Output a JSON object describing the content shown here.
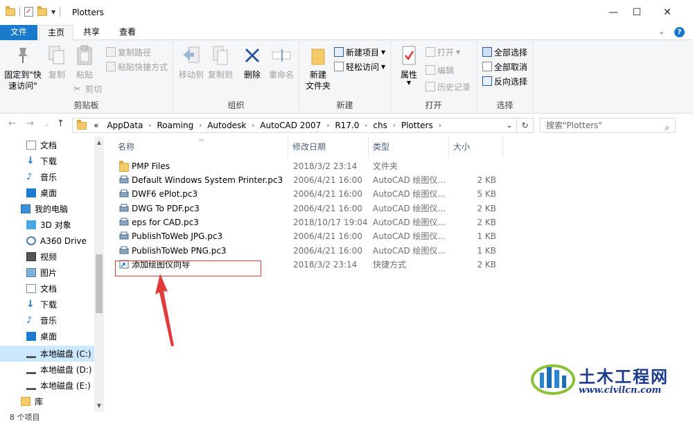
{
  "window": {
    "title": "Plotters"
  },
  "ribbon_tabs": {
    "file": "文件",
    "home": "主页",
    "share": "共享",
    "view": "查看"
  },
  "ribbon": {
    "clipboard": {
      "label": "剪贴板",
      "pin_line1": "固定到\"快",
      "pin_line2": "速访问\"",
      "copy": "复制",
      "paste": "粘贴",
      "copy_path": "复制路径",
      "paste_shortcut": "粘贴快捷方式",
      "cut": "剪切"
    },
    "organize": {
      "label": "组织",
      "move_to": "移动到",
      "copy_to": "复制到",
      "delete": "删除",
      "rename": "重命名"
    },
    "new": {
      "label": "新建",
      "new_folder_line1": "新建",
      "new_folder_line2": "文件夹",
      "new_item": "新建项目",
      "easy_access": "轻松访问"
    },
    "open": {
      "label": "打开",
      "properties": "属性",
      "open": "打开",
      "edit": "编辑",
      "history": "历史记录"
    },
    "select": {
      "label": "选择",
      "select_all": "全部选择",
      "select_none": "全部取消",
      "invert": "反向选择"
    }
  },
  "address": {
    "overflow": "«",
    "crumbs": [
      "AppData",
      "Roaming",
      "Autodesk",
      "AutoCAD 2007",
      "R17.0",
      "chs",
      "Plotters"
    ],
    "search_placeholder": "搜索\"Plotters\""
  },
  "nav": {
    "items": [
      {
        "label": "文档",
        "icon": "document-icon"
      },
      {
        "label": "下载",
        "icon": "download-icon"
      },
      {
        "label": "音乐",
        "icon": "music-icon"
      },
      {
        "label": "桌面",
        "icon": "desktop-icon"
      },
      {
        "label": "我的电脑",
        "icon": "computer-icon"
      },
      {
        "label": "3D 对象",
        "icon": "3d-objects-icon"
      },
      {
        "label": "A360 Drive",
        "icon": "cloud-drive-icon"
      },
      {
        "label": "视频",
        "icon": "video-icon"
      },
      {
        "label": "图片",
        "icon": "picture-icon"
      },
      {
        "label": "文档",
        "icon": "document-icon"
      },
      {
        "label": "下载",
        "icon": "download-icon"
      },
      {
        "label": "音乐",
        "icon": "music-icon"
      },
      {
        "label": "桌面",
        "icon": "desktop-icon"
      },
      {
        "label": "本地磁盘 (C:)",
        "icon": "drive-icon"
      },
      {
        "label": "本地磁盘 (D:)",
        "icon": "drive-icon"
      },
      {
        "label": "本地磁盘 (E:)",
        "icon": "drive-icon"
      },
      {
        "label": "库",
        "icon": "library-icon"
      }
    ]
  },
  "columns": {
    "name": "名称",
    "date": "修改日期",
    "type": "类型",
    "size": "大小"
  },
  "files": [
    {
      "name": "PMP Files",
      "date": "2018/3/2 23:14",
      "type": "文件夹",
      "size": "",
      "icon": "folder-icon"
    },
    {
      "name": "Default Windows System Printer.pc3",
      "date": "2006/4/21 16:00",
      "type": "AutoCAD 绘图仪...",
      "size": "2 KB",
      "icon": "plotter-file-icon"
    },
    {
      "name": "DWF6 ePlot.pc3",
      "date": "2006/4/21 16:00",
      "type": "AutoCAD 绘图仪...",
      "size": "5 KB",
      "icon": "plotter-file-icon"
    },
    {
      "name": "DWG To PDF.pc3",
      "date": "2006/4/21 16:00",
      "type": "AutoCAD 绘图仪...",
      "size": "2 KB",
      "icon": "plotter-file-icon"
    },
    {
      "name": "eps for CAD.pc3",
      "date": "2018/10/17 19:04",
      "type": "AutoCAD 绘图仪...",
      "size": "2 KB",
      "icon": "plotter-file-icon"
    },
    {
      "name": "PublishToWeb JPG.pc3",
      "date": "2006/4/21 16:00",
      "type": "AutoCAD 绘图仪...",
      "size": "1 KB",
      "icon": "plotter-file-icon"
    },
    {
      "name": "PublishToWeb PNG.pc3",
      "date": "2006/4/21 16:00",
      "type": "AutoCAD 绘图仪...",
      "size": "1 KB",
      "icon": "plotter-file-icon"
    },
    {
      "name": "添加绘图仪向导",
      "date": "2018/3/2 23:14",
      "type": "快捷方式",
      "size": "2 KB",
      "icon": "shortcut-icon"
    }
  ],
  "status": {
    "count": "8 个项目"
  },
  "watermark": {
    "title": "土木工程网",
    "url": "www.civilcn.com"
  },
  "colors": {
    "accent": "#1979ca",
    "highlight_box": "#e03c3c",
    "selected_nav": "#cce8ff"
  }
}
